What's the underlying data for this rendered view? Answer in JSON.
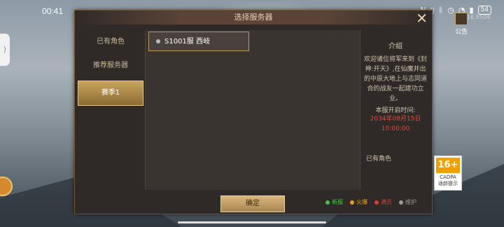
{
  "status": {
    "time": "00:41",
    "battery": "54",
    "version": "1.16.8509"
  },
  "notice": {
    "label": "公告"
  },
  "dialog": {
    "title": "选择服务器",
    "close": "✕",
    "sidebar": [
      "已有角色",
      "推荐服务器",
      "赛季1"
    ],
    "server": {
      "name": "S1001服 西岐"
    },
    "info": {
      "title": "介绍",
      "text": "欢迎诸位将军来到《封神:开天》,在仙魔并出的中原大地上与志同道合的战友一起建功立业。",
      "open_label": "本服开启时间:",
      "open_date": "2034年08月15日",
      "open_time": "10:00:00",
      "role_label": "已有角色"
    },
    "confirm": "确定",
    "legend": [
      {
        "label": "新服",
        "color": "#44c444"
      },
      {
        "label": "火爆",
        "color": "#e6a020"
      },
      {
        "label": "满员",
        "color": "#e03a2e"
      },
      {
        "label": "维护",
        "color": "#9a9a9a"
      }
    ]
  },
  "age_badge": {
    "num": "16+",
    "org": "CADPA",
    "label": "适龄提示"
  }
}
